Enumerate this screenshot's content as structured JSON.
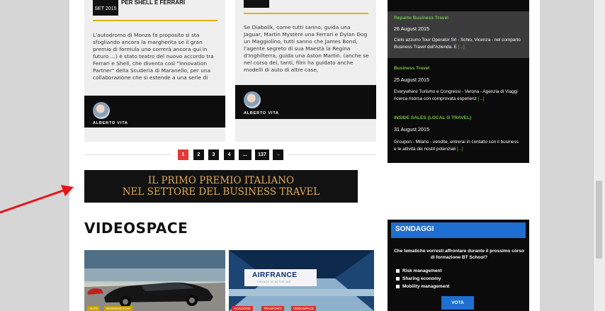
{
  "cards": [
    {
      "headline": "PER SHELL E FERRARI",
      "date": "SET 2015",
      "excerpt": "L'autodromo di Monza fa proposito si sta sfogliando ancora la margherita se il gran premio di formula uno correrà ancora qui in futuro …) è stato teatro del nuovo accordo tra Ferrari e Shell, che diventa così \"Innovation Partner\" della Scuderia di Maranello, per una collaborazione che si estende a una serie di",
      "author": "ALBERTO VITA"
    },
    {
      "headline": "",
      "date": "",
      "excerpt": "Se Diabolik, come tutti sanno, guida una Jaguar, Martin Mystère una Ferrari e Dylan Dog un Maggiolino, tutti sanno che James Bond, l'agente segreto di sua Maestà la Regina d'Inghilterra, guida una Aston Martin. (anche se nel corso dei, tanti, film ha guidato anche modelli di auto di altre case,",
      "author": "ALBERTO VITA"
    }
  ],
  "sidebar": {
    "items": [
      {
        "category": "Reparto Business Travel",
        "date": "26 August 2015",
        "text": "Cielo azzurro Tour Operator Srl - Schio, Vicenza - nel comparto Business Travel dell'Azienda. E",
        "more": "[...]"
      },
      {
        "category": "Business Travel",
        "date": "25 August 2015",
        "text": "Everywhere Turismo e Congressi - Verona - Agenzia di Viaggi ricerca risorsa con comprovata esperienz",
        "more": "[...]"
      },
      {
        "category": "INSIDE SALES (LOCAL O TRAVEL)",
        "date": "31 August 2015",
        "text": "Groupon - Milano - vendite, entrerai in contatto con il business e le attività dei nostri potenziali",
        "more": "[...]"
      }
    ]
  },
  "pagination": {
    "pages": [
      "1",
      "2",
      "3",
      "4",
      "...",
      "137"
    ],
    "next": "→",
    "active": "1"
  },
  "banner": {
    "line1": "IL PRIMO PREMIO ITALIANO",
    "line2": "NEL SETTORE DEL BUSINESS TRAVEL"
  },
  "videospace": {
    "title": "VIDEOSPACE",
    "thumb1_tags": [
      "AUTO",
      "BUSINESS CAR"
    ],
    "thumb2_tags": [
      "AVIAZIONE",
      "TRASPORTI",
      "VIDEOSPACE"
    ],
    "thumb2_sign": "AIRFRANCE",
    "thumb2_sub": "FRANCE IS IN THE AIR"
  },
  "poll": {
    "title": "SONDAGGI",
    "question": "Che tematiche vorresti affrontare durante il prossimo corso di formazione BT School?",
    "options": [
      "Risk management",
      "Sharing economy",
      "Mobility management"
    ],
    "vote": "VOTA"
  },
  "colors": {
    "accent_red": "#e53935",
    "sidebar_green": "#6ec046",
    "poll_blue": "#1e6fd0",
    "banner_gold": "#e0a95b",
    "annotation_arrow": "#e8131b"
  }
}
